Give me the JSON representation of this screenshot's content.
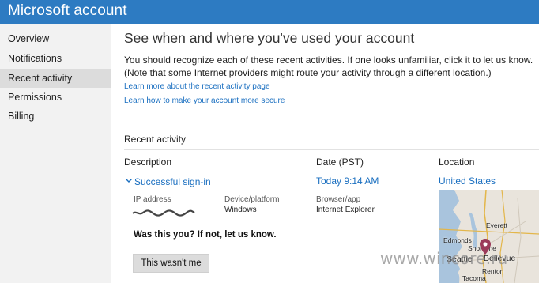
{
  "app": {
    "title": "Microsoft account"
  },
  "sidebar": {
    "items": [
      {
        "label": "Overview"
      },
      {
        "label": "Notifications"
      },
      {
        "label": "Recent activity",
        "active": true
      },
      {
        "label": "Permissions"
      },
      {
        "label": "Billing"
      }
    ]
  },
  "main": {
    "heading": "See when and where you've used your account",
    "intro": "You should recognize each of these recent activities. If one looks unfamiliar, click it to let us know. (Note that some Internet providers might route your activity through a different location.)",
    "links": [
      "Learn more about the recent activity page",
      "Learn how to make your account more secure"
    ],
    "section_title": "Recent activity",
    "columns": {
      "description": "Description",
      "date": "Date (PST)",
      "location": "Location"
    },
    "activity": {
      "description": "Successful sign-in",
      "date": "Today 9:14 AM",
      "location": "United States",
      "details": {
        "ip_label": "IP address",
        "device_label": "Device/platform",
        "device_value": "Windows",
        "browser_label": "Browser/app",
        "browser_value": "Internet Explorer"
      },
      "question": "Was this you? If not, let us know.",
      "button": "This wasn't me"
    },
    "map": {
      "labels": [
        "Everett",
        "Edmonds",
        "Shoreline",
        "Seattle",
        "Bellevue",
        "Renton",
        "Tacoma"
      ]
    }
  },
  "watermark": "www.wincore.ru",
  "colors": {
    "topbar": "#2d7bc2",
    "link": "#1a6fc0",
    "sidebar_bg": "#f2f2f2",
    "sidebar_active": "#dcdcdc",
    "map_pin": "#9b3a5a"
  }
}
